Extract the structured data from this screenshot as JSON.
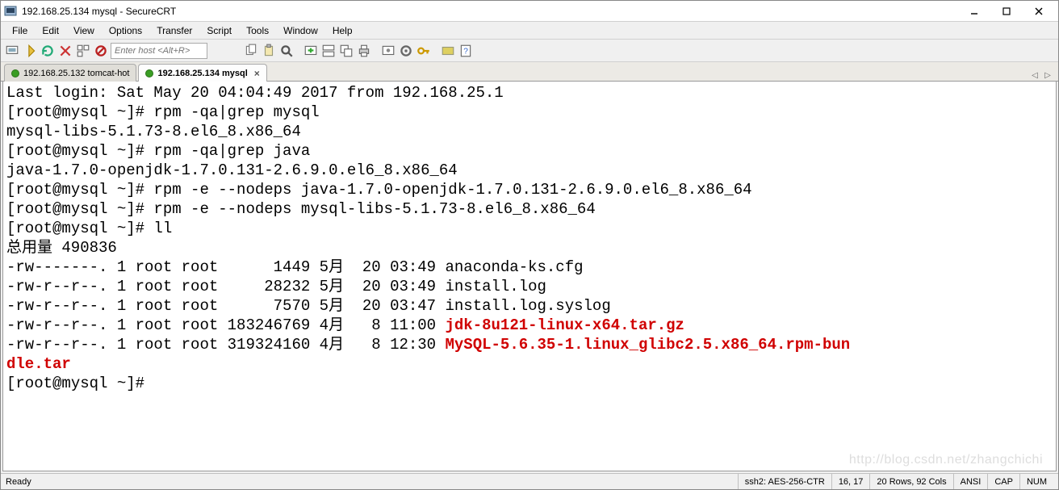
{
  "window": {
    "title": "192.168.25.134 mysql - SecureCRT"
  },
  "menu": {
    "file": "File",
    "edit": "Edit",
    "view": "View",
    "options": "Options",
    "transfer": "Transfer",
    "script": "Script",
    "tools": "Tools",
    "window": "Window",
    "help": "Help"
  },
  "toolbar": {
    "host_placeholder": "Enter host <Alt+R>"
  },
  "tabs": [
    {
      "label": "192.168.25.132 tomcat-hot",
      "active": false
    },
    {
      "label": "192.168.25.134 mysql",
      "active": true
    }
  ],
  "terminal": {
    "lines": [
      {
        "text": "Last login: Sat May 20 04:04:49 2017 from 192.168.25.1"
      },
      {
        "text": "[root@mysql ~]# rpm -qa|grep mysql"
      },
      {
        "text": "mysql-libs-5.1.73-8.el6_8.x86_64"
      },
      {
        "text": "[root@mysql ~]# rpm -qa|grep java"
      },
      {
        "text": "java-1.7.0-openjdk-1.7.0.131-2.6.9.0.el6_8.x86_64"
      },
      {
        "text": "[root@mysql ~]# rpm -e --nodeps java-1.7.0-openjdk-1.7.0.131-2.6.9.0.el6_8.x86_64"
      },
      {
        "text": "[root@mysql ~]# rpm -e --nodeps mysql-libs-5.1.73-8.el6_8.x86_64"
      },
      {
        "text": "[root@mysql ~]# ll"
      },
      {
        "text": "总用量 490836"
      },
      {
        "text": "-rw-------. 1 root root      1449 5月  20 03:49 anaconda-ks.cfg"
      },
      {
        "text": "-rw-r--r--. 1 root root     28232 5月  20 03:49 install.log"
      },
      {
        "text": "-rw-r--r--. 1 root root      7570 5月  20 03:47 install.log.syslog"
      },
      {
        "prefix": "-rw-r--r--. 1 root root 183246769 4月   8 11:00 ",
        "hl": "jdk-8u121-linux-x64.tar.gz"
      },
      {
        "prefix": "-rw-r--r--. 1 root root 319324160 4月   8 12:30 ",
        "hl": "MySQL-5.6.35-1.linux_glibc2.5.x86_64.rpm-bun"
      },
      {
        "hl": "dle.tar"
      },
      {
        "text": "[root@mysql ~]# "
      }
    ]
  },
  "statusbar": {
    "ready": "Ready",
    "conn": "ssh2: AES-256-CTR",
    "cursor": "16,  17",
    "size": "20 Rows, 92 Cols",
    "encoding": "ANSI",
    "cap": "CAP",
    "num": "NUM"
  },
  "watermark": "http://blog.csdn.net/zhangchichi"
}
